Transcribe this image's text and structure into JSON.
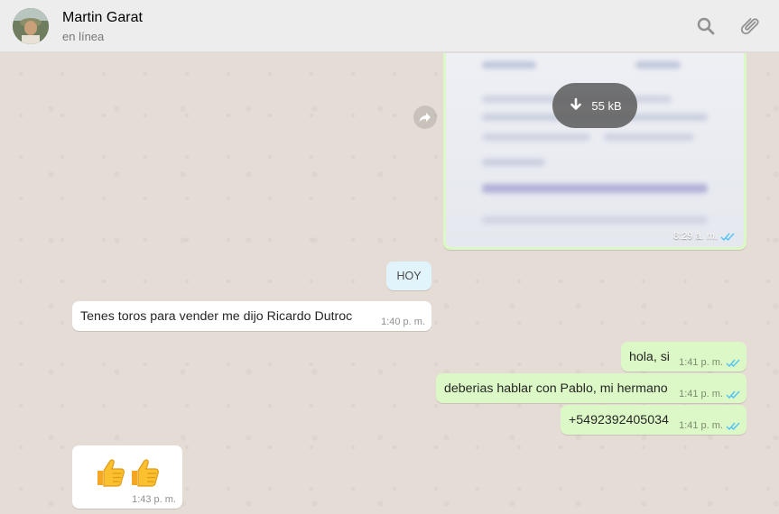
{
  "header": {
    "contact_name": "Martin Garat",
    "status": "en línea",
    "icons": [
      "search-icon",
      "attach-icon"
    ]
  },
  "image_message": {
    "download_size": "55 kB",
    "time": "8:29 a. m.",
    "status": "read"
  },
  "day_divider": "HOY",
  "messages": [
    {
      "direction": "in",
      "text": "Tenes toros para vender me dijo Ricardo Dutroc",
      "time": "1:40 p. m."
    },
    {
      "direction": "out",
      "text": "hola, si",
      "time": "1:41 p. m.",
      "status": "read"
    },
    {
      "direction": "out",
      "text": "deberias hablar con Pablo, mi hermano",
      "time": "1:41 p. m.",
      "status": "read"
    },
    {
      "direction": "out",
      "text": "+5492392405034",
      "time": "1:41 p. m.",
      "status": "read"
    },
    {
      "direction": "in",
      "text": "👍👍",
      "time": "1:43 p. m."
    }
  ],
  "colors": {
    "header_bg": "#ededed",
    "chat_bg": "#e5ddd5",
    "incoming_bubble": "#ffffff",
    "outgoing_bubble": "#dcf8c6",
    "read_ticks": "#4fc3f7",
    "day_chip": "#e1f3fb"
  }
}
